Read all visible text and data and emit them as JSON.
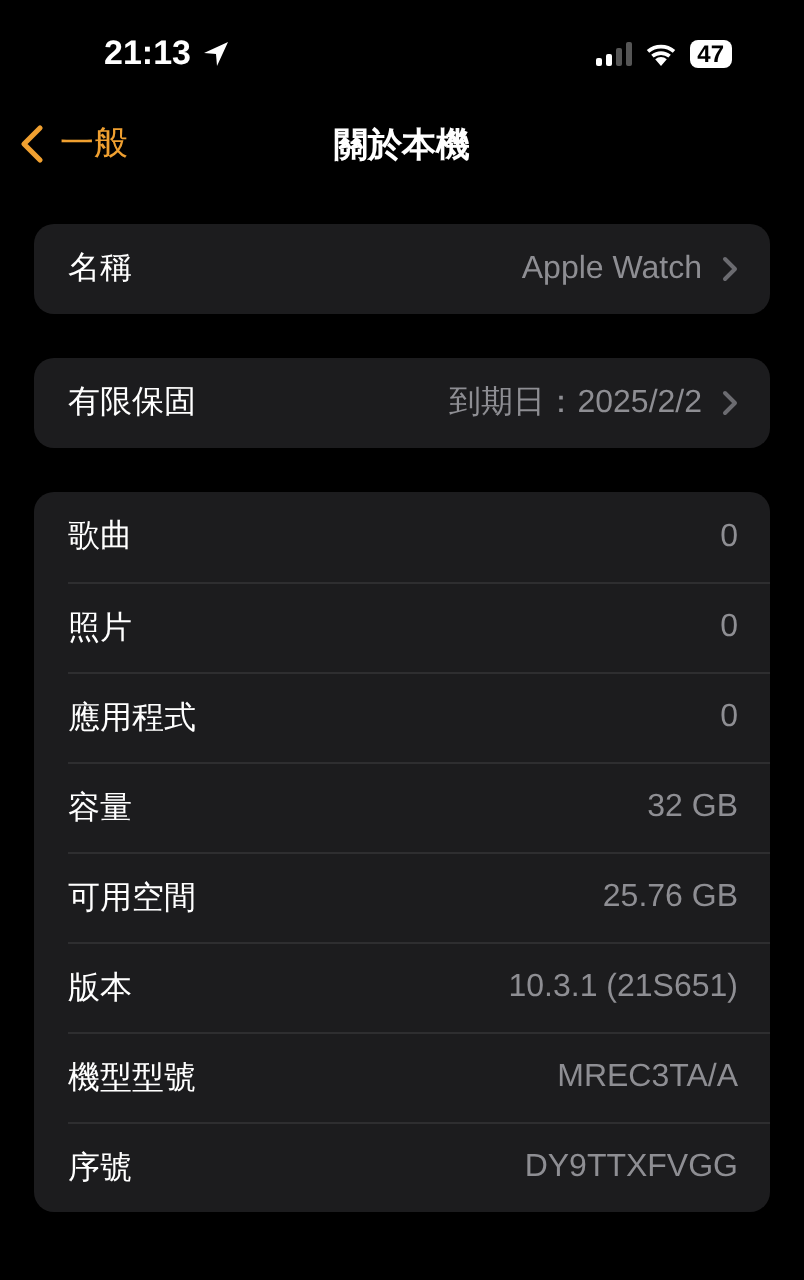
{
  "status_bar": {
    "time": "21:13",
    "battery": "47"
  },
  "nav": {
    "back": "一般",
    "title": "關於本機"
  },
  "groups": [
    {
      "rows": [
        {
          "label": "名稱",
          "value": "Apple Watch",
          "disclosure": true
        }
      ]
    },
    {
      "rows": [
        {
          "label": "有限保固",
          "value": "到期日：2025/2/2",
          "disclosure": true
        }
      ]
    },
    {
      "rows": [
        {
          "label": "歌曲",
          "value": "0"
        },
        {
          "label": "照片",
          "value": "0"
        },
        {
          "label": "應用程式",
          "value": "0"
        },
        {
          "label": "容量",
          "value": "32 GB"
        },
        {
          "label": "可用空間",
          "value": "25.76 GB"
        },
        {
          "label": "版本",
          "value": "10.3.1 (21S651)"
        },
        {
          "label": "機型型號",
          "value": "MREC3TA/A"
        },
        {
          "label": "序號",
          "value": "DY9TTXFVGG"
        }
      ]
    }
  ]
}
